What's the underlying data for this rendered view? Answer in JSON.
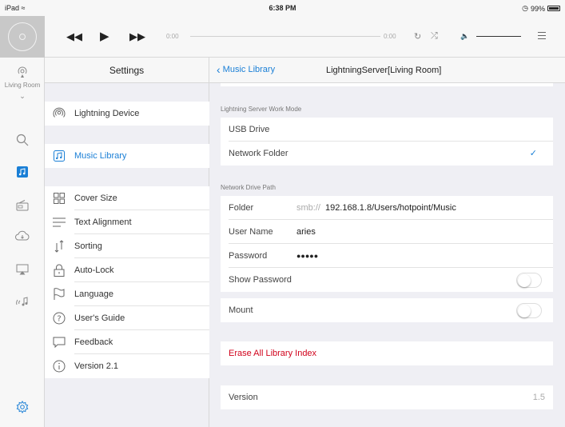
{
  "status": {
    "carrier": "iPad",
    "time": "6:38 PM",
    "battery": "99%"
  },
  "player": {
    "time_start": "0:00",
    "time_end": "0:00"
  },
  "rail": {
    "room_label": "Living Room"
  },
  "settings": {
    "title": "Settings",
    "groups": [
      [
        {
          "label": "Lightning Device",
          "icon": "wifi-icon"
        }
      ],
      [
        {
          "label": "Music Library",
          "icon": "music-library-icon",
          "active": true
        }
      ],
      [
        {
          "label": "Cover Size",
          "icon": "grid-icon"
        },
        {
          "label": "Text Alignment",
          "icon": "align-icon"
        },
        {
          "label": "Sorting",
          "icon": "sort-icon"
        },
        {
          "label": "Auto-Lock",
          "icon": "lock-icon"
        },
        {
          "label": "Language",
          "icon": "flag-icon"
        },
        {
          "label": "User's Guide",
          "icon": "help-icon"
        },
        {
          "label": "Feedback",
          "icon": "chat-icon"
        },
        {
          "label": "Version 2.1",
          "icon": "info-icon"
        }
      ]
    ]
  },
  "detail": {
    "back_label": "Music Library",
    "title": "LightningServer[Living Room]",
    "work_mode": {
      "section_label": "Lightning Server Work Mode",
      "options": [
        {
          "label": "USB Drive",
          "selected": false
        },
        {
          "label": "Network Folder",
          "selected": true
        }
      ]
    },
    "drive_path": {
      "section_label": "Network Drive Path",
      "folder_label": "Folder",
      "folder_prefix": "smb://",
      "folder_value": "192.168.1.8/Users/hotpoint/Music",
      "user_label": "User Name",
      "user_value": "aries",
      "password_label": "Password",
      "password_value": "●●●●●",
      "show_password_label": "Show Password",
      "show_password_on": false
    },
    "mount": {
      "label": "Mount",
      "on": false
    },
    "erase_label": "Erase All Library Index",
    "version": {
      "label": "Version",
      "value": "1.5"
    }
  },
  "colors": {
    "accent": "#1a7fd6",
    "danger": "#d0021b"
  }
}
